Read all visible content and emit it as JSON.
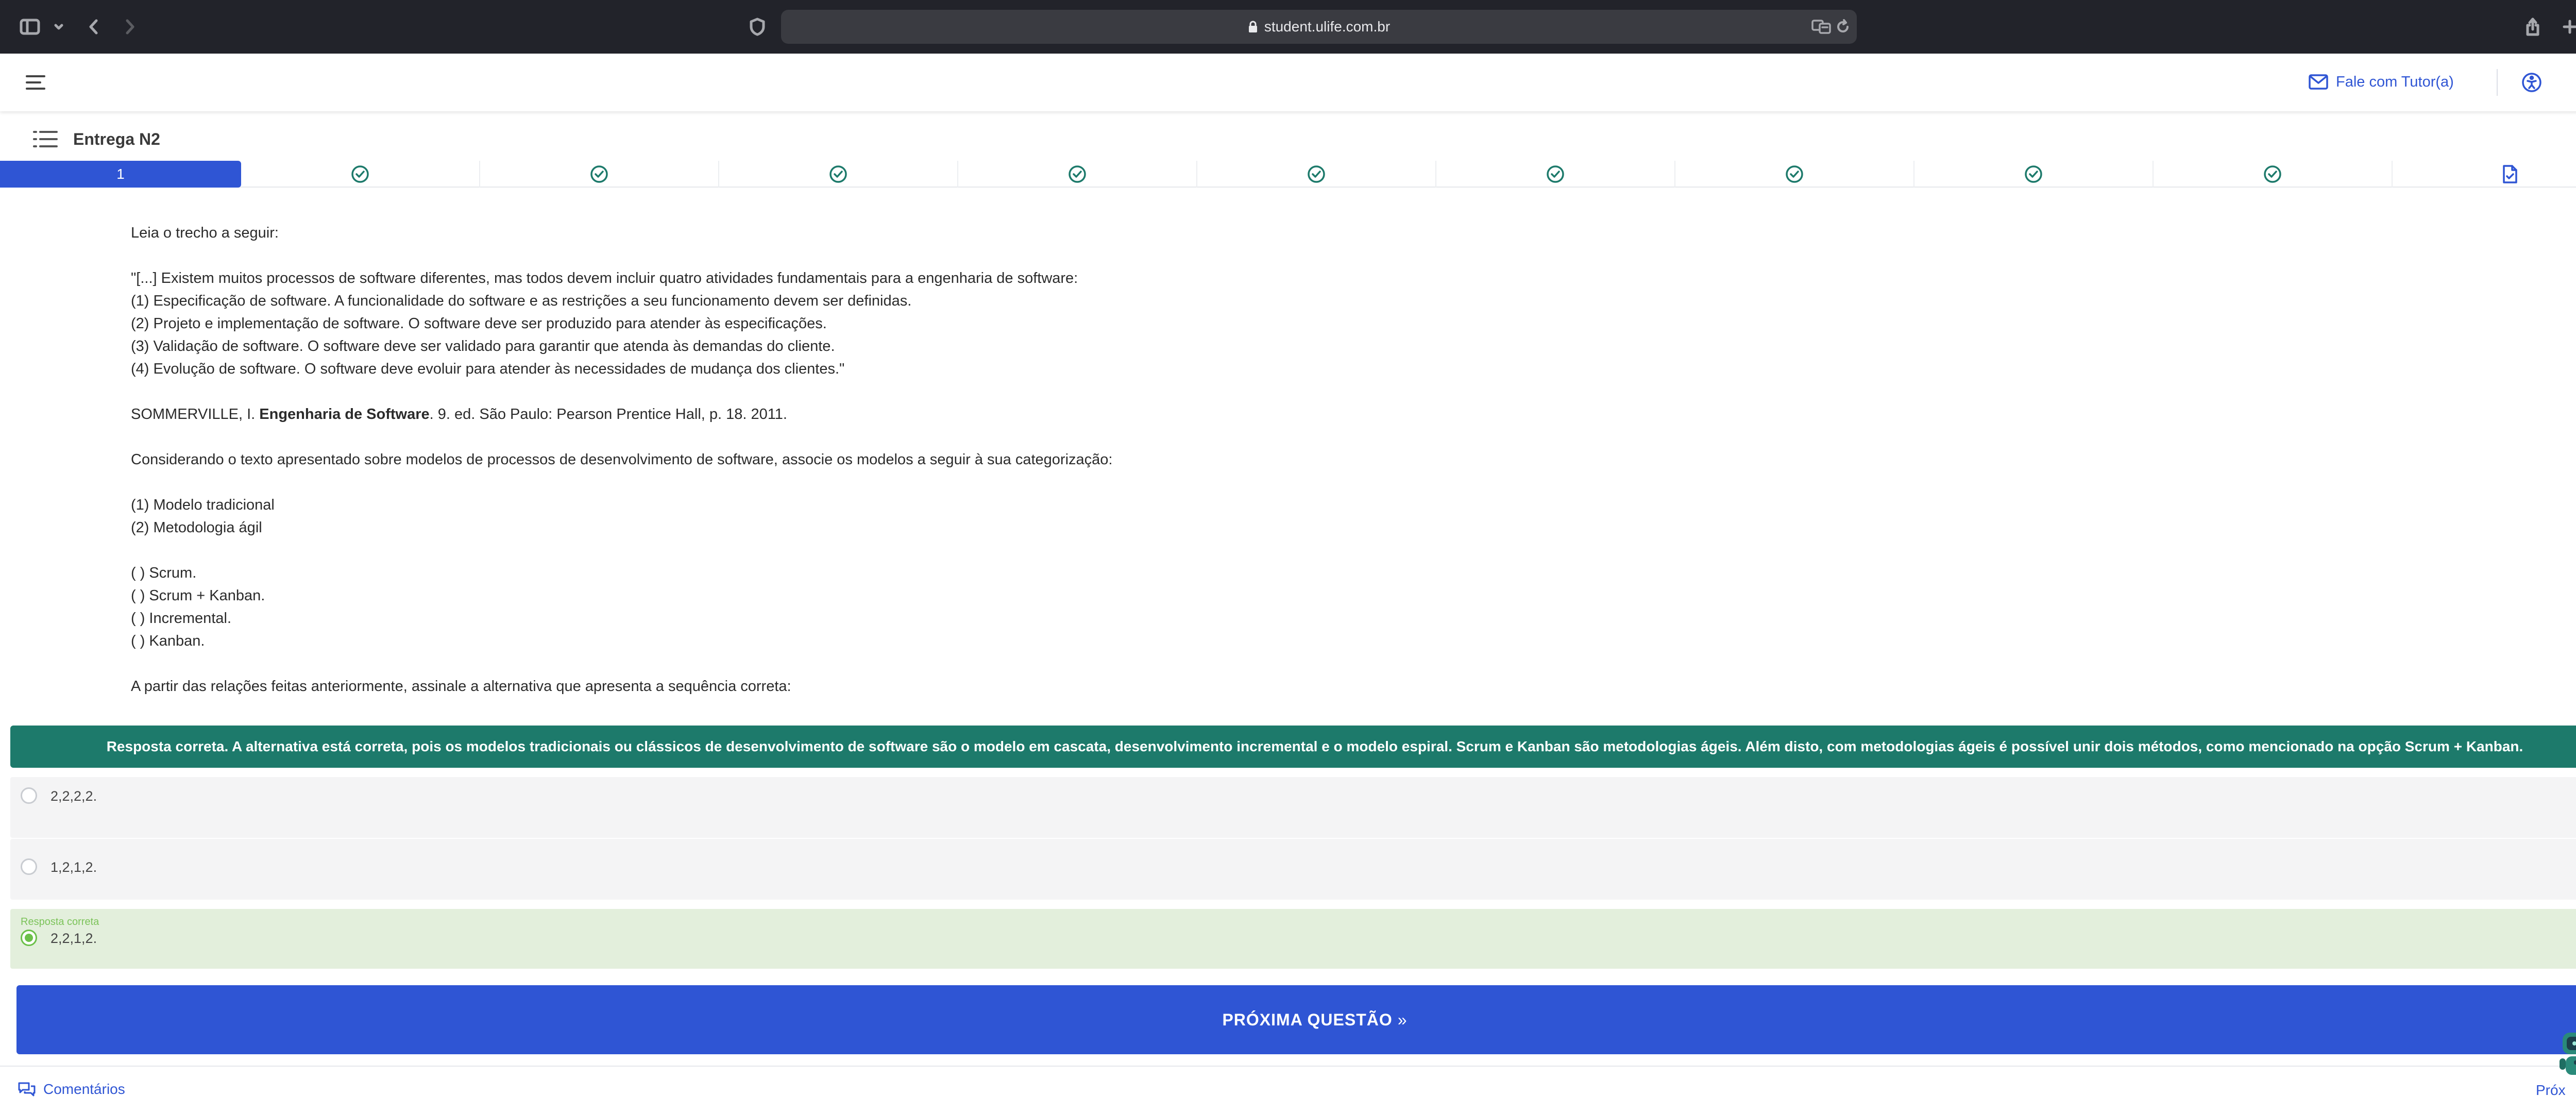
{
  "browser": {
    "url": "student.ulife.com.br"
  },
  "header": {
    "tutor_label": "Fale com Tutor(a)"
  },
  "activity": {
    "title": "Entrega N2"
  },
  "stepper": {
    "active_label": "1"
  },
  "question": {
    "intro": "Leia o trecho a seguir:",
    "quote_lines": [
      "\"[...] Existem muitos processos de software diferentes, mas todos devem incluir quatro atividades fundamentais para a engenharia de software:",
      "(1)  Especificação de software. A funcionalidade do software e as restrições a seu funcionamento devem ser definidas.",
      "(2)  Projeto e implementação de software. O software deve ser produzido para atender às especificações.",
      "(3)  Validação de software. O software deve ser validado para garantir que atenda às demandas do cliente.",
      "(4)  Evolução de software. O software deve evoluir para atender às necessidades de mudança dos clientes.\""
    ],
    "reference_author": "SOMMERVILLE, I. ",
    "reference_title": "Engenharia de Software",
    "reference_rest": ". 9. ed. São Paulo: Pearson Prentice Hall, p. 18. 2011.",
    "prompt": "Considerando o texto apresentado sobre modelos de processos de desenvolvimento de software, associe os modelos a seguir à sua categorização:",
    "categories": [
      "(1)  Modelo tradicional",
      "(2)  Metodologia ágil"
    ],
    "items": [
      "( ) Scrum.",
      "( ) Scrum + Kanban.",
      "( ) Incremental.",
      "( ) Kanban."
    ],
    "instruction": "A partir das relações feitas anteriormente, assinale a alternativa que apresenta a sequência correta:"
  },
  "feedback": {
    "text": "Resposta correta. A alternativa está correta, pois os modelos tradicionais ou clássicos de desenvolvimento de software são o modelo em cascata, desenvolvimento incremental e o modelo espiral. Scrum e Kanban são metodologias ágeis. Além disto, com metodologias ágeis é possível unir dois métodos, como mencionado na opção Scrum + Kanban.",
    "color": "#1d7a6b"
  },
  "options": [
    {
      "label": "2,2,2,2."
    },
    {
      "label": "1,2,1,2."
    },
    {
      "label": "2,2,1,2.",
      "tag": "Resposta correta"
    }
  ],
  "next_button": {
    "label": "PRÓXIMA QUESTÃO",
    "arrow": "»"
  },
  "footer": {
    "comments_label": "Comentários",
    "next_label": "Próx"
  },
  "colors": {
    "primary": "#2f55d4",
    "success": "#6cc04a",
    "chrome": "#22232a"
  }
}
